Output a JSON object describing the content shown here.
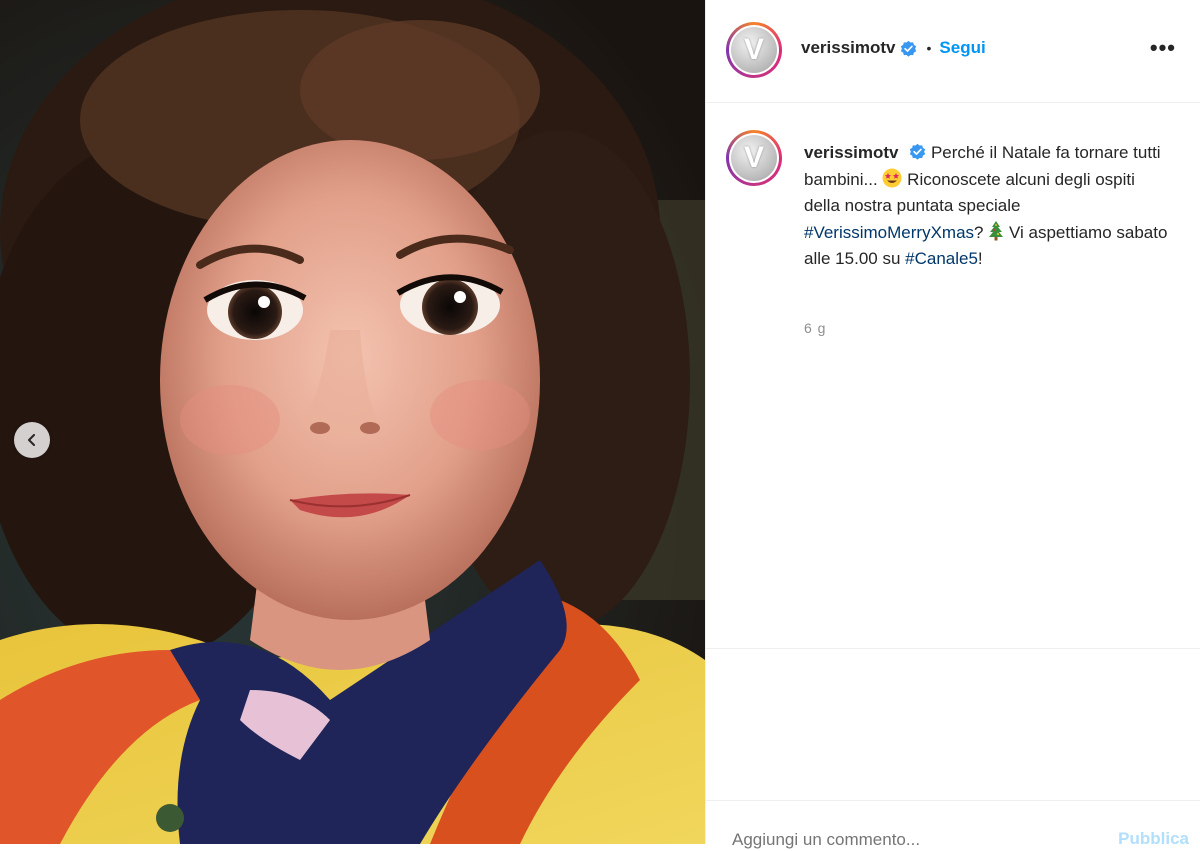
{
  "post": {
    "username": "verissimotv",
    "verified": true,
    "follow_label": "Segui",
    "separator": "•",
    "more_label": "•••",
    "avatar_letter": "V"
  },
  "caption": {
    "username": "verissimotv",
    "text_1": "Perché il Natale fa tornare tutti bambini...",
    "text_2": "Riconoscete alcuni degli ospiti della nostra puntata speciale",
    "hashtag_1": "#VerissimoMerryXmas",
    "text_3": "?",
    "text_4": "Vi aspettiamo sabato alle 15.00 su",
    "hashtag_2": "#Canale5",
    "text_5": "!",
    "emoji_1": "star-struck-emoji",
    "emoji_2": "christmas-tree-emoji"
  },
  "meta": {
    "time_ago": "6 g"
  },
  "comment": {
    "placeholder": "Aggiungi un commento...",
    "publish_label": "Pubblica"
  },
  "colors": {
    "link_blue": "#0095f6",
    "hashtag": "#00376b",
    "muted": "#8e8e8e",
    "border": "#efefef"
  },
  "icons": {
    "carousel_prev": "chevron-left-icon",
    "verified": "verified-badge-icon"
  }
}
